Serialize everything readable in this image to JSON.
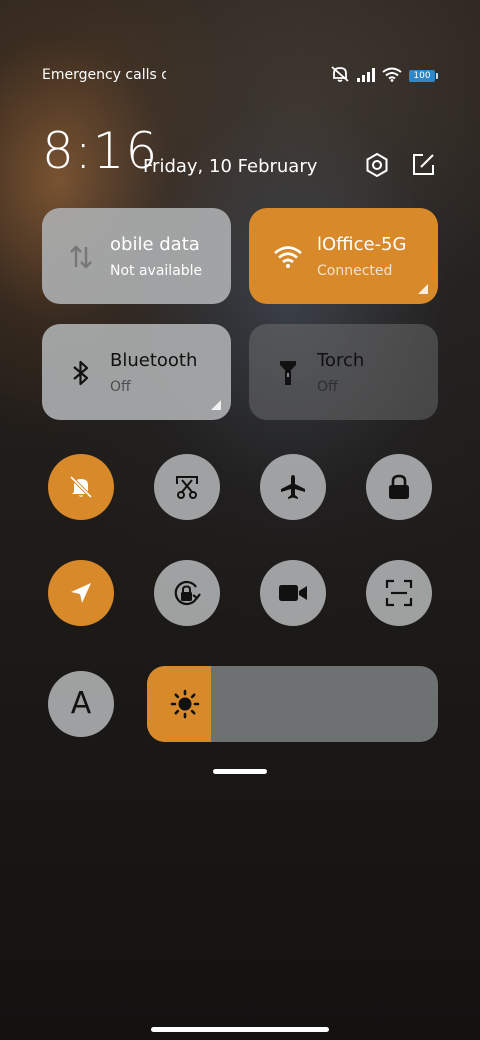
{
  "status_bar": {
    "carrier_text": "Emergency calls o",
    "battery_level": "100",
    "icons": [
      "mute-icon",
      "signal-icon",
      "wifi-icon",
      "battery-icon"
    ]
  },
  "header": {
    "time": "8:16",
    "date": "Friday, 10 February",
    "settings_icon": "settings-icon",
    "edit_icon": "edit-icon"
  },
  "tiles": [
    {
      "key": "mobile_data",
      "title": "obile data",
      "subtitle": "Not available",
      "icon": "mobile-data-icon",
      "active": false
    },
    {
      "key": "wifi",
      "title": "lOffice-5G",
      "subtitle": "Connected",
      "icon": "wifi-icon",
      "active": true
    },
    {
      "key": "bluetooth",
      "title": "Bluetooth",
      "subtitle": "Off",
      "icon": "bluetooth-icon",
      "active": false
    },
    {
      "key": "torch",
      "title": "Torch",
      "subtitle": "Off",
      "icon": "torch-icon",
      "active": false
    }
  ],
  "toggles": [
    {
      "key": "mute",
      "icon": "bell-off-icon",
      "active": true
    },
    {
      "key": "screenshot",
      "icon": "scissors-icon",
      "active": false
    },
    {
      "key": "airplane",
      "icon": "airplane-icon",
      "active": false
    },
    {
      "key": "lock",
      "icon": "lock-icon",
      "active": false
    },
    {
      "key": "location",
      "icon": "location-icon",
      "active": true
    },
    {
      "key": "rotation_lock",
      "icon": "rotation-lock-icon",
      "active": false
    },
    {
      "key": "screen_recorder",
      "icon": "video-camera-icon",
      "active": false
    },
    {
      "key": "scanner",
      "icon": "scan-icon",
      "active": false
    }
  ],
  "auto_brightness": {
    "label": "A"
  },
  "brightness": {
    "level": 0.22,
    "icon": "sun-icon"
  },
  "colors": {
    "accent": "#d8892a",
    "tile_grey": "#aaacae",
    "slider_track": "#6e7172"
  }
}
